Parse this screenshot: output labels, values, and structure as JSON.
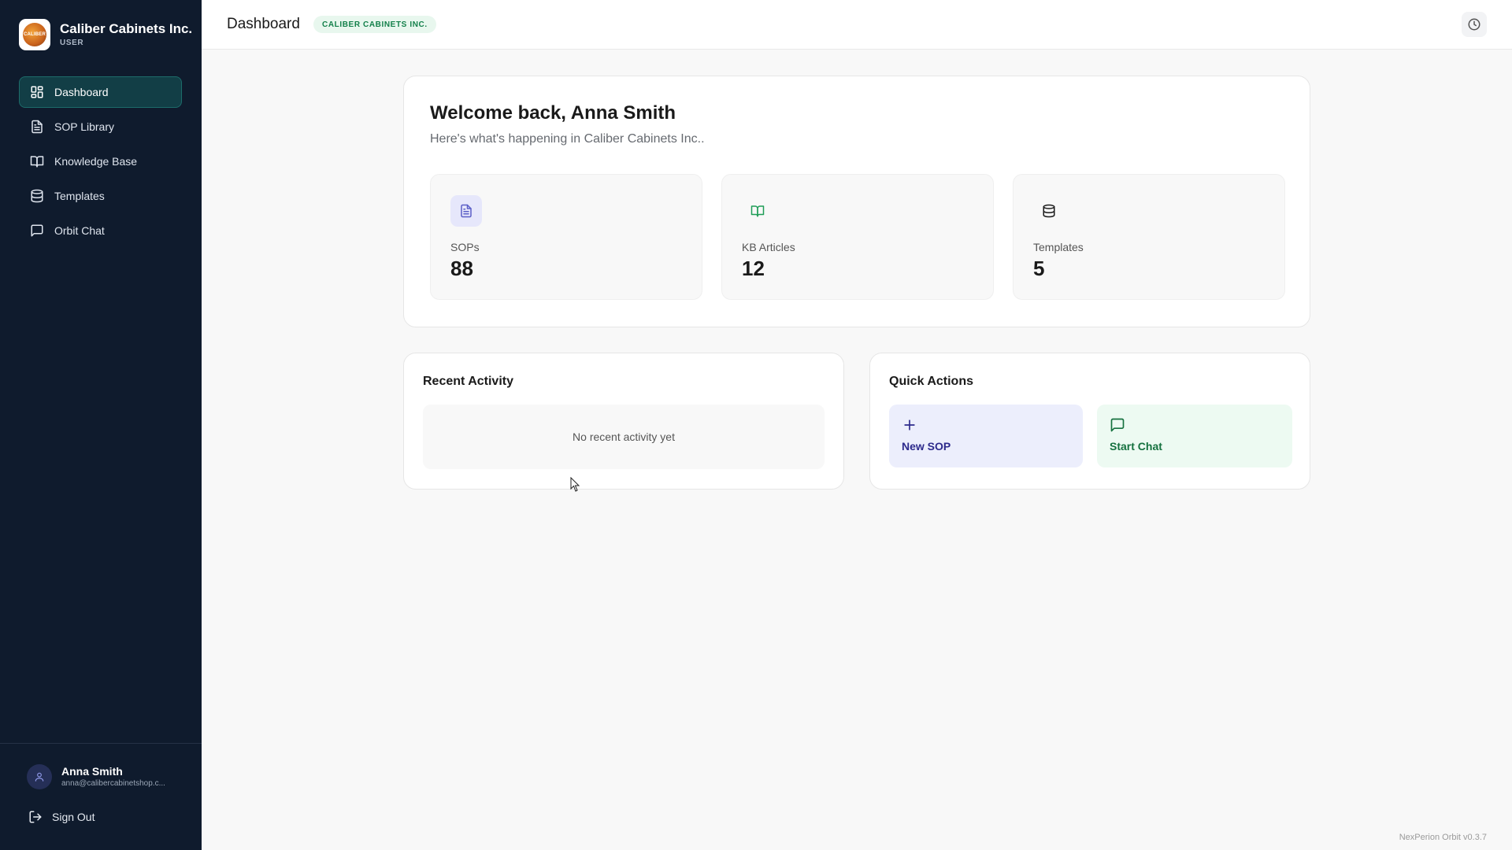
{
  "brand": {
    "name": "Caliber Cabinets Inc.",
    "role": "USER",
    "logo_text": "CALIBER"
  },
  "nav": {
    "items": [
      {
        "label": "Dashboard",
        "icon": "dashboard-grid-icon",
        "active": true
      },
      {
        "label": "SOP Library",
        "icon": "document-icon"
      },
      {
        "label": "Knowledge Base",
        "icon": "book-icon"
      },
      {
        "label": "Templates",
        "icon": "database-icon"
      },
      {
        "label": "Orbit Chat",
        "icon": "chat-icon"
      }
    ]
  },
  "user": {
    "name": "Anna Smith",
    "email": "anna@calibercabinetshop.c...",
    "sign_out_label": "Sign Out"
  },
  "header": {
    "title": "Dashboard",
    "org_badge": "CALIBER CABINETS INC.",
    "history_icon": "clock-icon"
  },
  "welcome": {
    "title": "Welcome back, Anna Smith",
    "subtitle": "Here's what's happening in Caliber Cabinets Inc.."
  },
  "stats": [
    {
      "label": "SOPs",
      "value": "88",
      "icon": "document-icon",
      "color": "#5b5fc7"
    },
    {
      "label": "KB Articles",
      "value": "12",
      "icon": "book-icon",
      "color": "#1f9d57"
    },
    {
      "label": "Templates",
      "value": "5",
      "icon": "database-icon",
      "color": "#1a1a1a"
    }
  ],
  "recent_activity": {
    "title": "Recent Activity",
    "empty_text": "No recent activity yet"
  },
  "quick_actions": {
    "title": "Quick Actions",
    "new_sop": "New SOP",
    "start_chat": "Start Chat"
  },
  "footer": {
    "version": "NexPerion Orbit v0.3.7"
  },
  "colors": {
    "sidebar_bg": "#0f1b2d",
    "active_nav_bg": "#123e46",
    "accent_green": "#13804a",
    "accent_indigo": "#2d2a8c"
  }
}
